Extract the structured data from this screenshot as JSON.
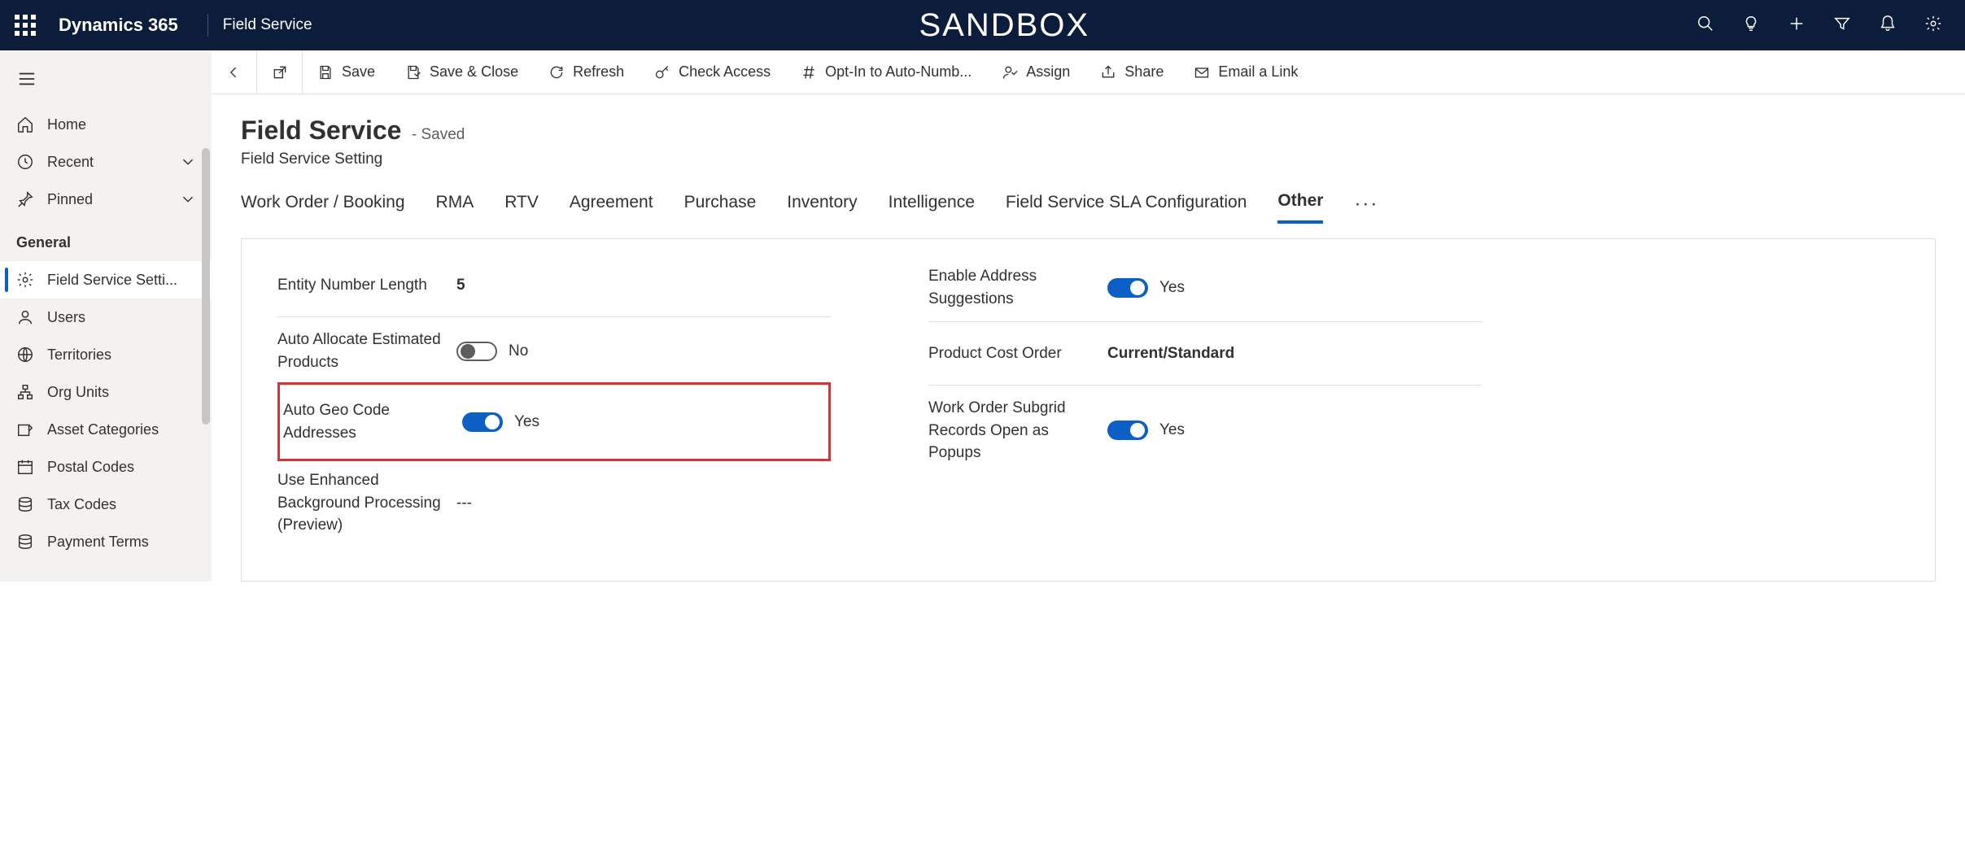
{
  "topbar": {
    "brand": "Dynamics 365",
    "area": "Field Service",
    "environment": "SANDBOX"
  },
  "sidebar": {
    "home": "Home",
    "recent": "Recent",
    "pinned": "Pinned",
    "section": "General",
    "items": [
      "Field Service Setti...",
      "Users",
      "Territories",
      "Org Units",
      "Asset Categories",
      "Postal Codes",
      "Tax Codes",
      "Payment Terms"
    ]
  },
  "commands": {
    "save": "Save",
    "save_close": "Save & Close",
    "refresh": "Refresh",
    "check_access": "Check Access",
    "opt_in": "Opt-In to Auto-Numb...",
    "assign": "Assign",
    "share": "Share",
    "email_link": "Email a Link"
  },
  "page": {
    "title": "Field Service",
    "status": "- Saved",
    "subtitle": "Field Service Setting"
  },
  "tabs": [
    "Work Order / Booking",
    "RMA",
    "RTV",
    "Agreement",
    "Purchase",
    "Inventory",
    "Intelligence",
    "Field Service SLA Configuration",
    "Other"
  ],
  "fields": {
    "left": {
      "entity_number_length": {
        "label": "Entity Number Length",
        "value": "5"
      },
      "auto_allocate": {
        "label": "Auto Allocate Estimated Products",
        "value": "No",
        "on": false
      },
      "auto_geo": {
        "label": "Auto Geo Code Addresses",
        "value": "Yes",
        "on": true
      },
      "enhanced_bg": {
        "label": "Use Enhanced Background Processing (Preview)",
        "value": "---"
      }
    },
    "right": {
      "address_suggest": {
        "label": "Enable Address Suggestions",
        "value": "Yes",
        "on": true
      },
      "product_cost": {
        "label": "Product Cost Order",
        "value": "Current/Standard"
      },
      "subgrid_popup": {
        "label": "Work Order Subgrid Records Open as Popups",
        "value": "Yes",
        "on": true
      }
    }
  }
}
